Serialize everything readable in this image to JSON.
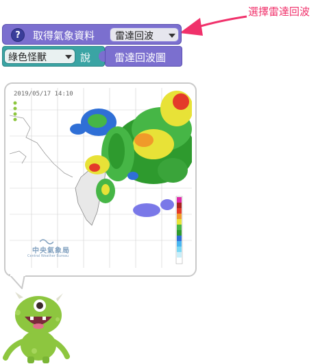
{
  "annotation": {
    "text": "選擇雷達回波",
    "color": "#f0316b"
  },
  "sensor_block": {
    "help_icon": "question-icon",
    "label": "取得氣象資料",
    "dropdown_value": "雷達回波",
    "color": "#7b6fcf"
  },
  "say_block": {
    "sprite_value": "綠色怪獸",
    "say_label": "說",
    "color": "#3aa4a4"
  },
  "radar_image_block": {
    "label": "雷達回波圖"
  },
  "radar_map": {
    "timestamp": "2019/05/17 14:10",
    "cwb_name": "中央氣象局",
    "cwb_name_en": "Central Weather Bureau"
  },
  "monster": {
    "icon": "green-monster-sprite",
    "color": "#8dc63f"
  }
}
